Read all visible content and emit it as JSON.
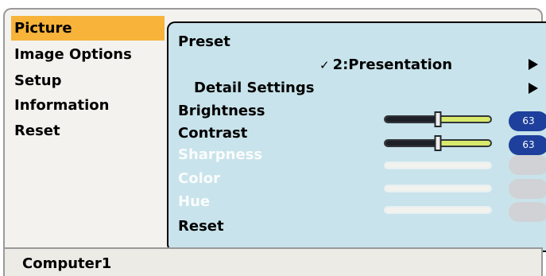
{
  "menu": {
    "items": [
      {
        "label": "Picture",
        "selected": true
      },
      {
        "label": "Image Options",
        "selected": false
      },
      {
        "label": "Setup",
        "selected": false
      },
      {
        "label": "Information",
        "selected": false
      },
      {
        "label": "Reset",
        "selected": false
      }
    ]
  },
  "panel": {
    "preset": {
      "label": "Preset",
      "check": "✓",
      "value": "2:Presentation"
    },
    "detail_settings": {
      "label": "Detail Settings"
    },
    "brightness": {
      "label": "Brightness",
      "value": "63",
      "level": 0.5
    },
    "contrast": {
      "label": "Contrast",
      "value": "63",
      "level": 0.5
    },
    "sharpness": {
      "label": "Sharpness",
      "enabled": false
    },
    "color": {
      "label": "Color",
      "enabled": false
    },
    "hue": {
      "label": "Hue",
      "enabled": false
    },
    "reset": {
      "label": "Reset"
    }
  },
  "status_bar": {
    "source": "Computer1"
  },
  "colors": {
    "menu_selected": "#f7b33a",
    "panel_background": "#c8e3eb",
    "value_badge": "#1e3f9c",
    "slider_track": "#d7ea6b"
  }
}
